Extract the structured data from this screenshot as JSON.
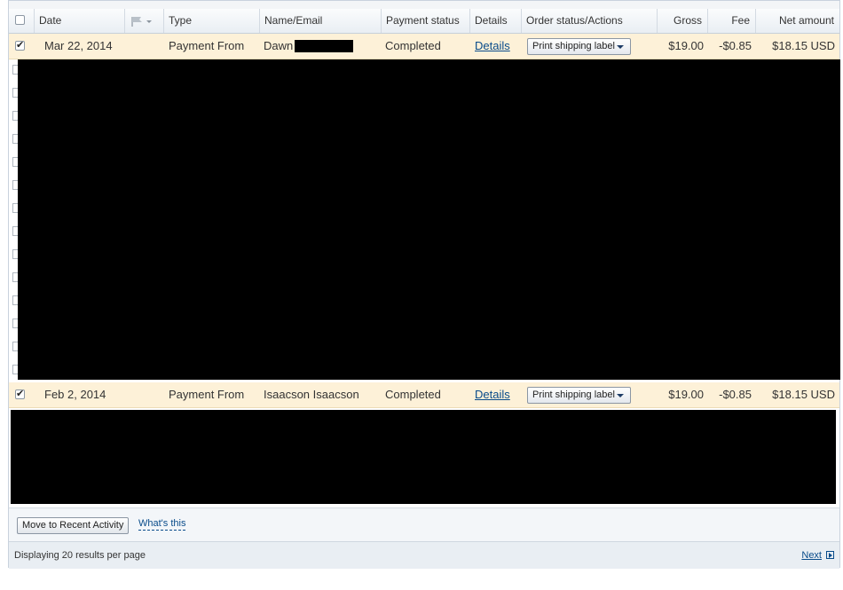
{
  "table": {
    "headers": {
      "date": "Date",
      "type": "Type",
      "name_email": "Name/Email",
      "payment_status": "Payment status",
      "details": "Details",
      "order_status": "Order status/Actions",
      "gross": "Gross",
      "fee": "Fee",
      "net_amount": "Net amount"
    },
    "flag_icon": "flag-icon",
    "rows": [
      {
        "checked": true,
        "date": "Mar 22, 2014",
        "type": "Payment From",
        "name": "Dawn",
        "payment_status": "Completed",
        "details_link": "Details",
        "action": "Print shipping label",
        "gross": "$19.00",
        "fee": "-$0.85",
        "net": "$18.15 USD"
      },
      {
        "checked": true,
        "date": "Feb 2, 2014",
        "type": "Payment From",
        "name": "Isaacson Isaacson",
        "payment_status": "Completed",
        "details_link": "Details",
        "action": "Print shipping label",
        "gross": "$19.00",
        "fee": "-$0.85",
        "net": "$18.15 USD"
      }
    ]
  },
  "actions": {
    "move_button": "Move to Recent Activity",
    "whats_this": "What's this"
  },
  "footer": {
    "results_text": "Displaying 20 results per page",
    "next_label": "Next"
  },
  "colors": {
    "row_highlight": "#fdf1d8",
    "link": "#084b8a",
    "header_bg": "#e9eef3"
  }
}
